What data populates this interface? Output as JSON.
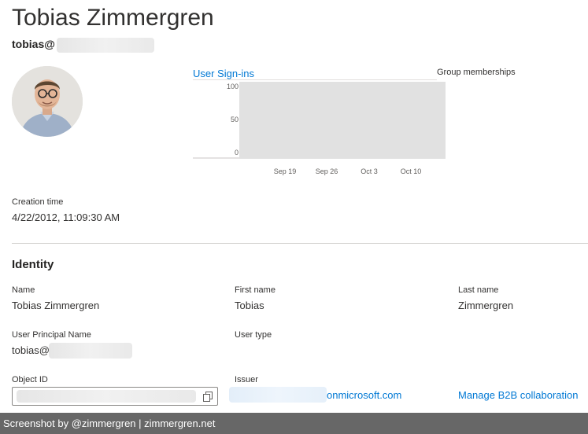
{
  "profile": {
    "display_name": "Tobias Zimmergren",
    "upn_prefix": "tobias@"
  },
  "chart": {
    "title": "User Sign-ins"
  },
  "chart_data": {
    "type": "bar",
    "title": "User Sign-ins",
    "categories": [
      "Sep 19",
      "Sep 26",
      "Oct 3",
      "Oct 10"
    ],
    "y_ticks": [
      "100",
      "50",
      "0"
    ],
    "ylim": [
      0,
      100
    ],
    "series": [],
    "grid": false
  },
  "group_memberships": {
    "label": "Group memberships"
  },
  "creation": {
    "label": "Creation time",
    "value": "4/22/2012, 11:09:30 AM"
  },
  "identity": {
    "title": "Identity",
    "name_label": "Name",
    "name_value": "Tobias Zimmergren",
    "first_name_label": "First name",
    "first_name_value": "Tobias",
    "last_name_label": "Last name",
    "last_name_value": "Zimmergren",
    "upn_label": "User Principal Name",
    "upn_value": "tobias@",
    "user_type_label": "User type",
    "object_id_label": "Object ID",
    "issuer_label": "Issuer",
    "issuer_value": "onmicrosoft.com",
    "b2b_link": "Manage B2B collaboration"
  },
  "footer": {
    "text": "Screenshot by @zimmergren | zimmergren.net"
  },
  "icons": {
    "copy": "copy-icon",
    "avatar": "avatar"
  },
  "colors": {
    "link": "#0078d4",
    "chart_bg": "#e1e1e1",
    "footer_bg": "#676767"
  }
}
